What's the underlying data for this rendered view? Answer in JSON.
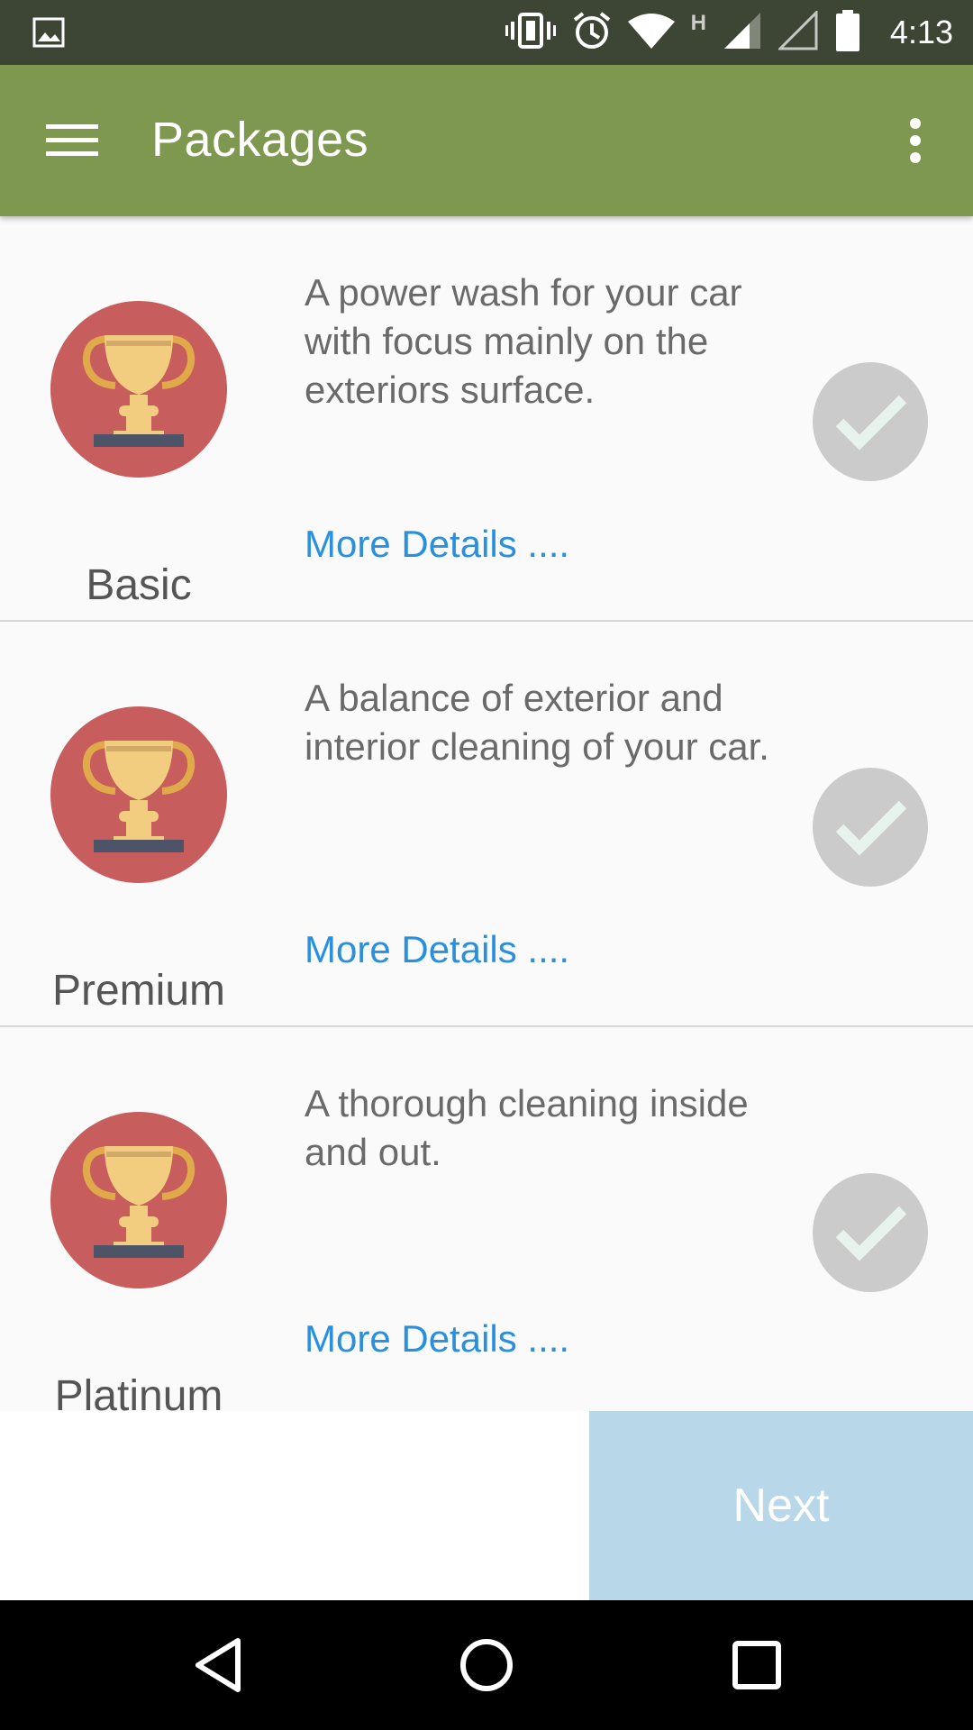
{
  "status_bar": {
    "time": "4:13",
    "network_type": "H",
    "icons": [
      "image-icon",
      "vibrate-icon",
      "alarm-icon",
      "wifi-icon",
      "signal-icon",
      "signal-empty-icon",
      "battery-icon"
    ]
  },
  "app_bar": {
    "title": "Packages",
    "menu_icon": "hamburger-menu-icon",
    "overflow_icon": "more-vert-icon"
  },
  "packages": [
    {
      "name": "Basic",
      "description": "A power wash for your car with focus mainly on the exteriors surface.",
      "more_label": "More Details ....",
      "icon": "trophy-icon",
      "selected": false
    },
    {
      "name": "Premium",
      "description": "A balance of exterior and interior cleaning of your car.",
      "more_label": "More Details ....",
      "icon": "trophy-icon",
      "selected": false
    },
    {
      "name": "Platinum",
      "description": "A thorough cleaning inside and out.",
      "more_label": "More Details ....",
      "icon": "trophy-icon",
      "selected": false
    }
  ],
  "footer": {
    "next_label": "Next"
  },
  "nav_bar": {
    "back_icon": "back-triangle-icon",
    "home_icon": "home-circle-icon",
    "recents_icon": "recents-square-icon"
  },
  "colors": {
    "status_bar": "#3d4634",
    "app_bar": "#7e9850",
    "trophy_circle": "#c85d5d",
    "link": "#2a8fdc",
    "next_button": "#b8d7e8"
  }
}
